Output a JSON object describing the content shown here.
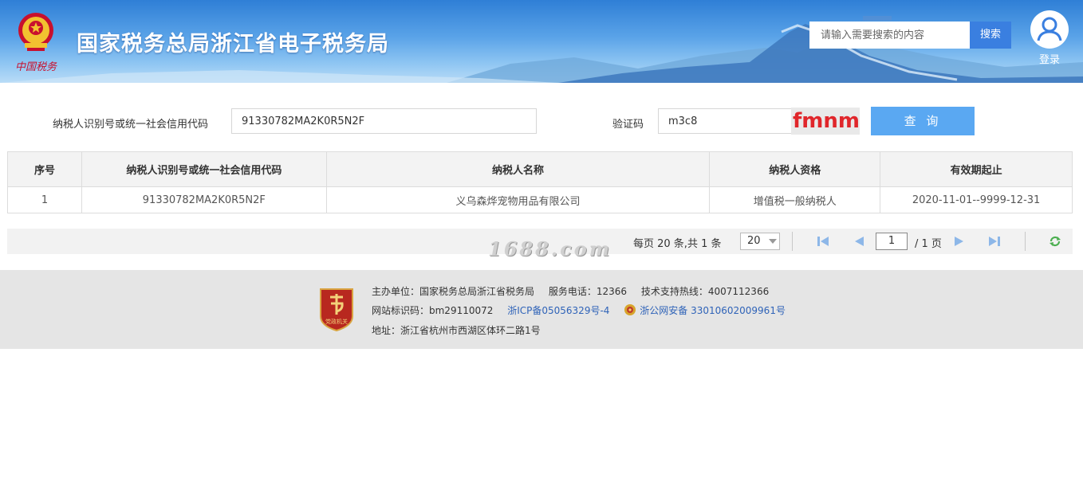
{
  "header": {
    "title": "国家税务总局浙江省电子税务局",
    "emblem_caption": "中国税务",
    "search_placeholder": "请输入需要搜索的内容",
    "search_button": "搜索",
    "login_label": "登录"
  },
  "query_form": {
    "taxpayer_id_label": "纳税人识别号或统一社会信用代码",
    "taxpayer_id_value": "91330782MA2K0R5N2F",
    "captcha_label": "验证码",
    "captcha_value": "m3c8",
    "captcha_image_text": "fmnm",
    "query_button": "查 询"
  },
  "results_table": {
    "columns": [
      "序号",
      "纳税人识别号或统一社会信用代码",
      "纳税人名称",
      "纳税人资格",
      "有效期起止"
    ],
    "rows": [
      [
        "1",
        "91330782MA2K0R5N2F",
        "义乌森烨宠物用品有限公司",
        "增值税一般纳税人",
        "2020-11-01--9999-12-31"
      ]
    ]
  },
  "pagination": {
    "summary": "每页 20 条,共 1 条",
    "page_size": "20",
    "current_page": "1",
    "total_pages_text": "/ 1 页"
  },
  "watermark": "1688.com",
  "footer": {
    "logo_caption": "党政机关",
    "sponsor": "主办单位：国家税务总局浙江省税务局",
    "service_phone": "服务电话：12366",
    "support_hotline": "技术支持热线：4007112366",
    "site_id": "网站标识码：bm29110072",
    "icp": "浙ICP备05056329号-4",
    "police_record": "浙公网安备 33010602009961号",
    "address": "地址：浙江省杭州市西湖区体环二路1号"
  },
  "colors": {
    "header_blue": "#2f7fd6",
    "search_button": "#3a7fe0",
    "query_button": "#5aa8f2",
    "captcha_text": "#e0262b",
    "footer_bg": "#e5e5e5",
    "link": "#2f63b8"
  }
}
